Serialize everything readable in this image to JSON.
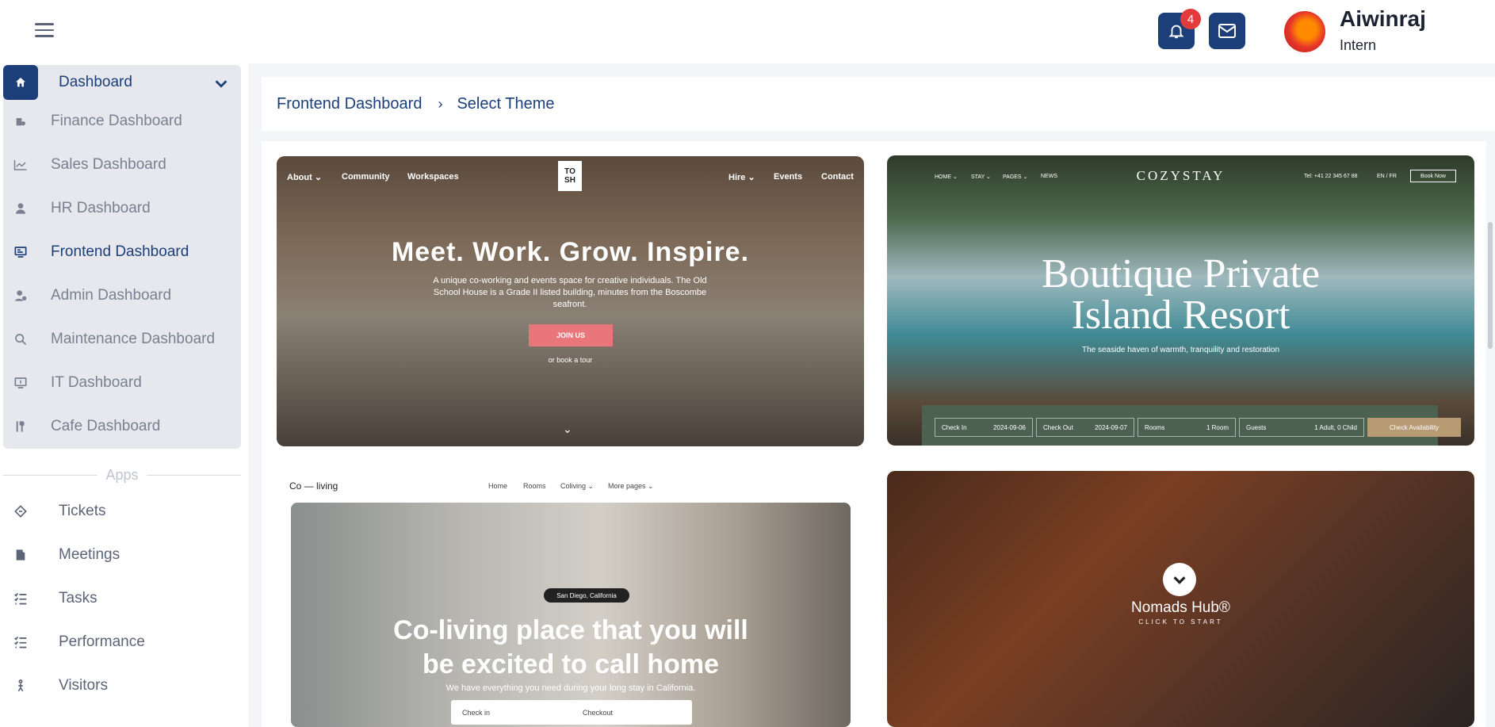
{
  "user": {
    "name": "Aiwinraj",
    "role": "Intern",
    "notification_count": "4"
  },
  "sidebar": {
    "dashboard_label": "Dashboard",
    "dashboards": [
      {
        "label": "Finance Dashboard",
        "icon": "finance-icon"
      },
      {
        "label": "Sales Dashboard",
        "icon": "chart-line-icon"
      },
      {
        "label": "HR Dashboard",
        "icon": "person-icon"
      },
      {
        "label": "Frontend Dashboard",
        "icon": "monitor-icon",
        "active": true
      },
      {
        "label": "Admin Dashboard",
        "icon": "admin-icon"
      },
      {
        "label": "Maintenance Dashboard",
        "icon": "maintenance-icon"
      },
      {
        "label": "IT Dashboard",
        "icon": "computer-icon"
      },
      {
        "label": "Cafe Dashboard",
        "icon": "cafe-icon"
      }
    ],
    "apps_section": "Apps",
    "apps": [
      {
        "label": "Tickets",
        "icon": "ticket-icon"
      },
      {
        "label": "Meetings",
        "icon": "door-icon"
      },
      {
        "label": "Tasks",
        "icon": "tasklist-icon"
      },
      {
        "label": "Performance",
        "icon": "tasklist-icon"
      },
      {
        "label": "Visitors",
        "icon": "visitor-icon"
      }
    ]
  },
  "breadcrumb": {
    "parent": "Frontend Dashboard",
    "separator": "›",
    "current": "Select Theme"
  },
  "themes": {
    "tosh": {
      "nav_left": [
        "About ⌄",
        "Community",
        "Workspaces"
      ],
      "logo": "TO SH",
      "nav_right": [
        "Hire ⌄",
        "Events",
        "Contact"
      ],
      "headline": "Meet. Work. Grow. Inspire.",
      "subtext": "A unique co-working and events space for creative individuals. The Old School House is a Grade II listed building, minutes from the Boscombe seafront.",
      "cta": "JOIN US",
      "secondary": "or book a tour"
    },
    "cozystay": {
      "nav": [
        "HOME ⌄",
        "STAY ⌄",
        "PAGES ⌄",
        "NEWS"
      ],
      "brand": "COZYSTAY",
      "phone": "Tel: +41 22 345 67 88",
      "lang": "EN / FR",
      "book": "Book Now",
      "headline_1": "Boutique Private",
      "headline_2": "Island Resort",
      "subtext": "The seaside haven of warmth, tranquility and restoration",
      "fields": [
        {
          "label": "Check In",
          "value": "2024-09-06"
        },
        {
          "label": "Check Out",
          "value": "2024-09-07"
        },
        {
          "label": "Rooms",
          "value": "1 Room"
        },
        {
          "label": "Guests",
          "value": "1 Adult, 0 Child"
        }
      ],
      "cta": "Check Availability"
    },
    "coliving": {
      "logo": "Co — living",
      "nav": [
        "Home",
        "Rooms",
        "Coliving ⌄",
        "More pages ⌄"
      ],
      "location": "San Diego, California",
      "headline_1": "Co-living place that you will",
      "headline_2": "be excited to call home",
      "subtext": "We have everything you need during your long stay in California.",
      "checkin": "Check in",
      "checkout": "Checkout"
    },
    "nomads": {
      "title": "Nomads Hub®",
      "subtitle": "CLICK TO START"
    }
  },
  "colors": {
    "brand": "#1c3f7a",
    "badge": "#e23b3b",
    "cta_pink": "#e8767a",
    "cozy_green": "#4d6150",
    "cozy_gold": "#b79b72"
  }
}
